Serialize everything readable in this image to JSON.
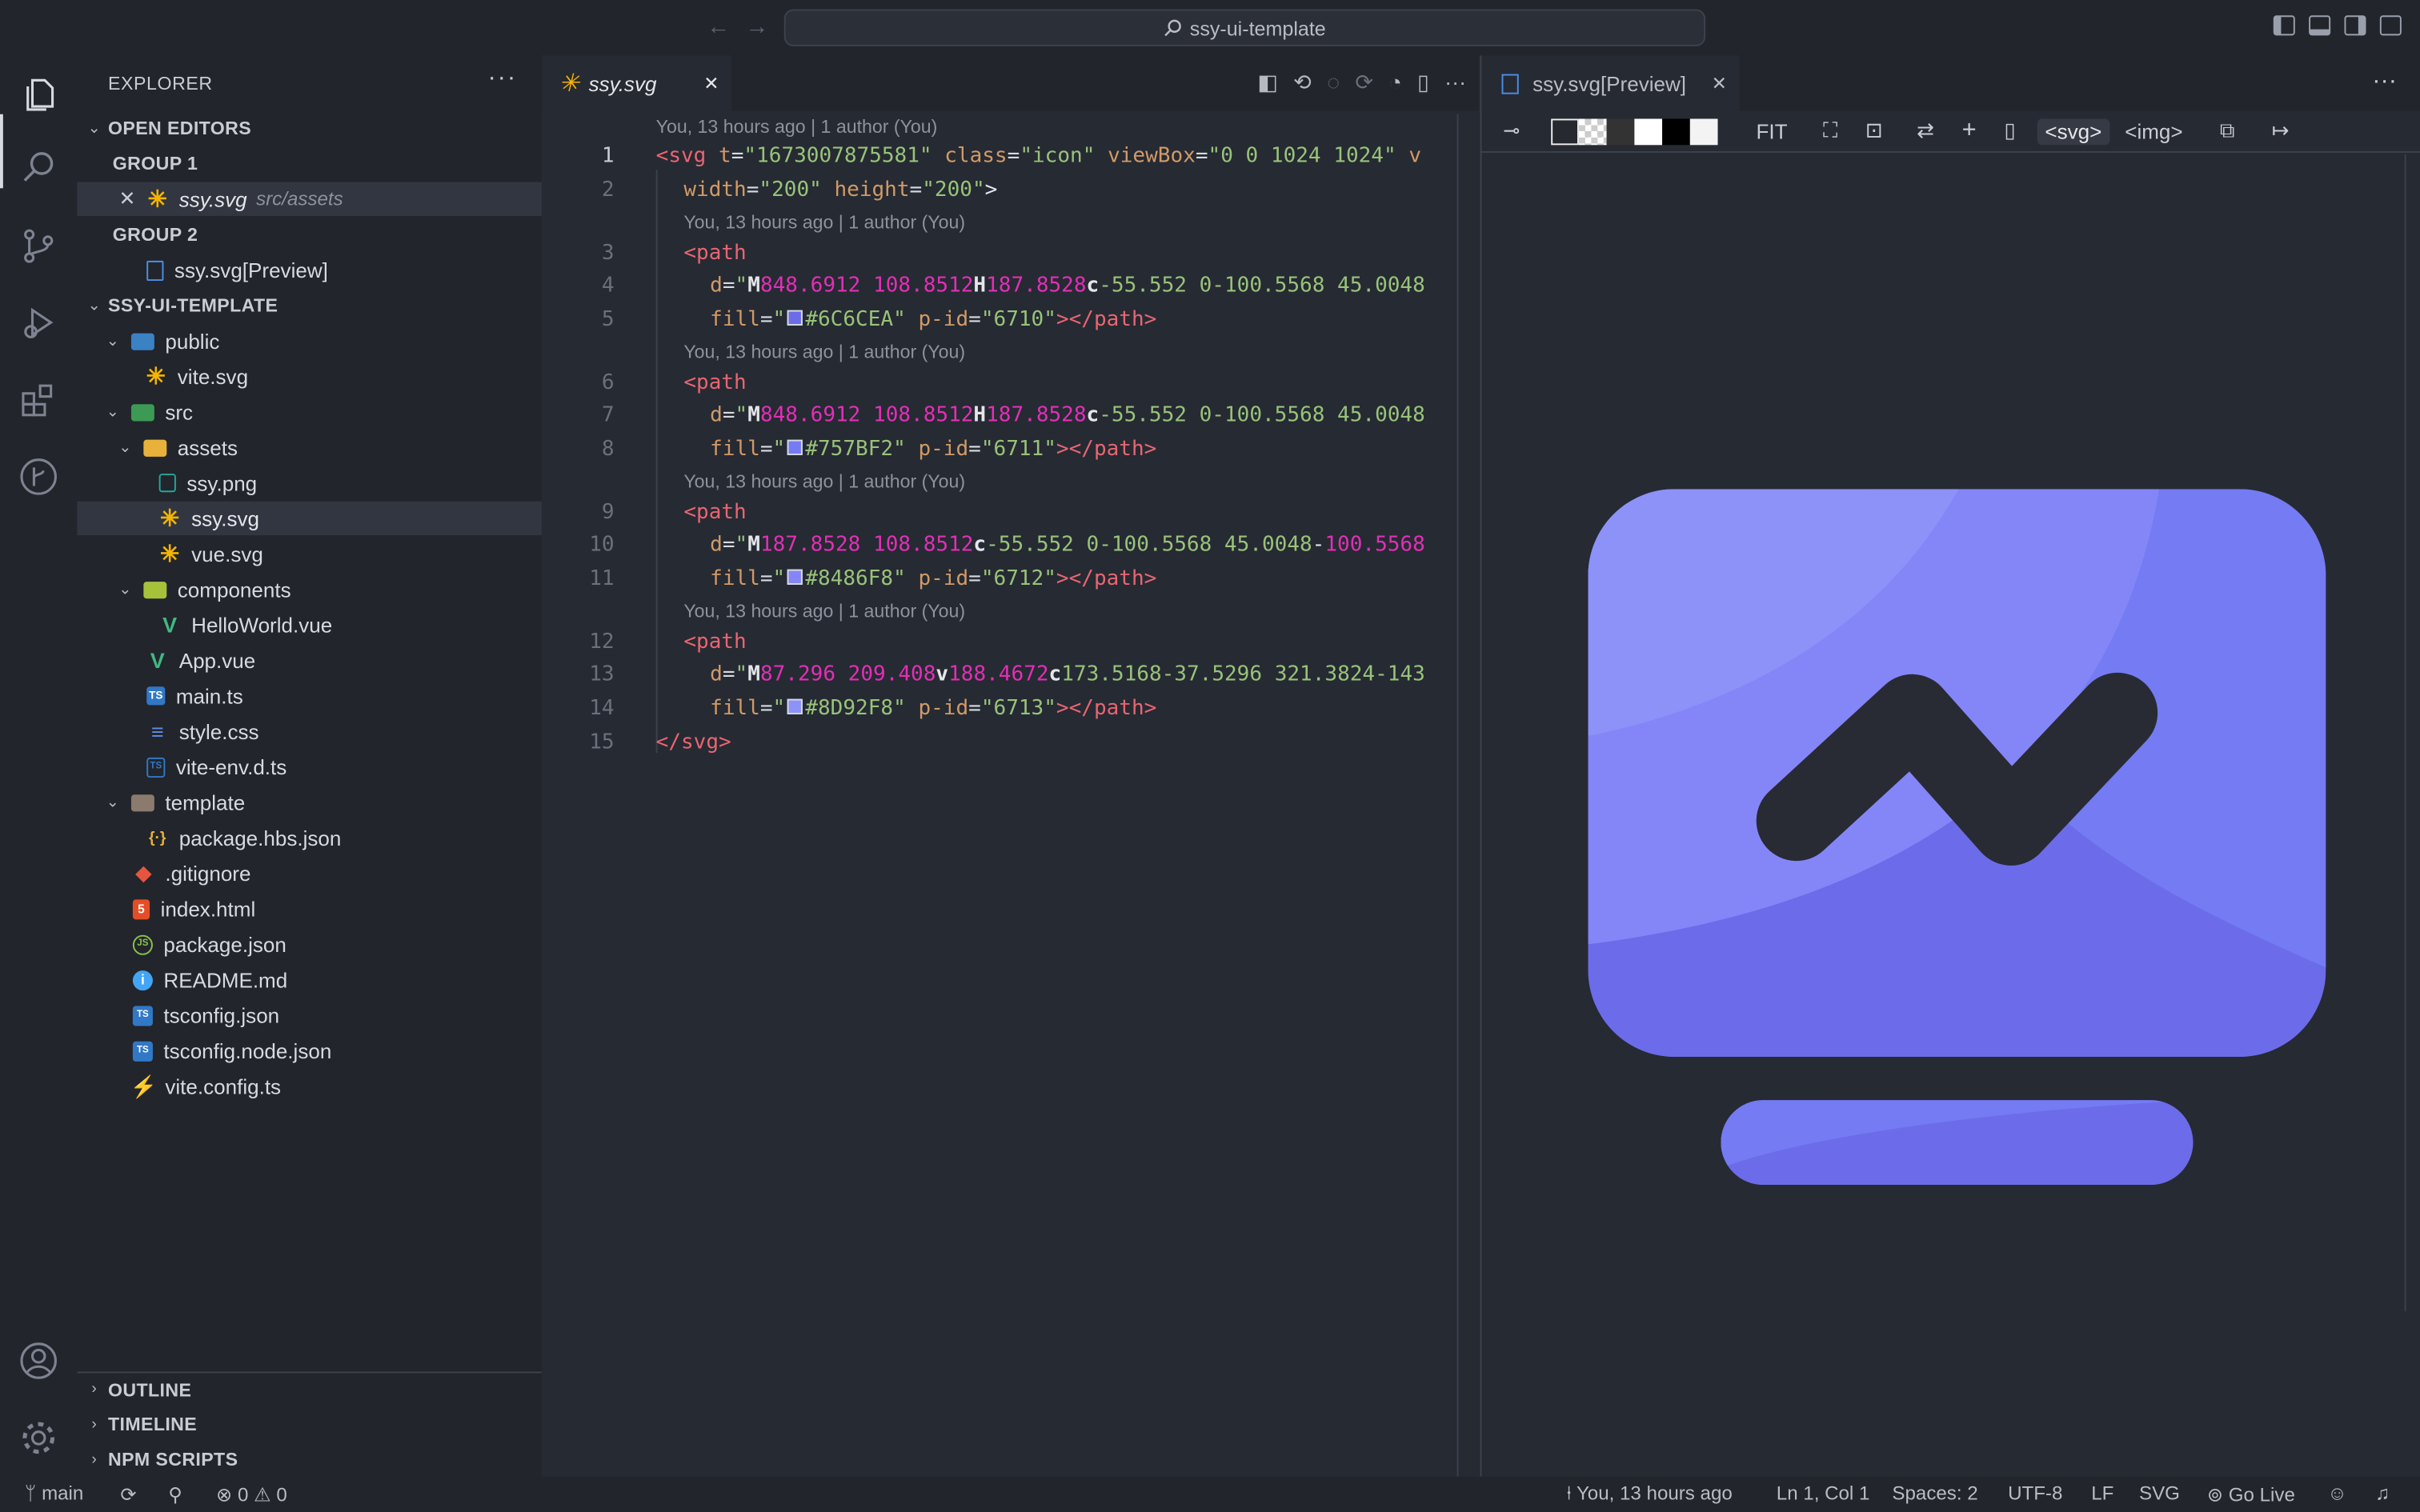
{
  "titlebar": {
    "search_text": "ssy-ui-template"
  },
  "sidebar": {
    "title": "EXPLORER",
    "open_editors": "OPEN EDITORS",
    "group1": "GROUP 1",
    "group1_file": "ssy.svg",
    "group1_path": "src/assets",
    "group2": "GROUP 2",
    "group2_file": "ssy.svg[Preview]",
    "project": "SSY-UI-TEMPLATE",
    "tree": [
      {
        "label": "public"
      },
      {
        "label": "vite.svg"
      },
      {
        "label": "src"
      },
      {
        "label": "assets"
      },
      {
        "label": "ssy.png"
      },
      {
        "label": "ssy.svg"
      },
      {
        "label": "vue.svg"
      },
      {
        "label": "components"
      },
      {
        "label": "HelloWorld.vue"
      },
      {
        "label": "App.vue"
      },
      {
        "label": "main.ts"
      },
      {
        "label": "style.css"
      },
      {
        "label": "vite-env.d.ts"
      },
      {
        "label": "template"
      },
      {
        "label": "package.hbs.json"
      },
      {
        "label": ".gitignore"
      },
      {
        "label": "index.html"
      },
      {
        "label": "package.json"
      },
      {
        "label": "README.md"
      },
      {
        "label": "tsconfig.json"
      },
      {
        "label": "tsconfig.node.json"
      },
      {
        "label": "vite.config.ts"
      }
    ],
    "outline": "OUTLINE",
    "timeline": "TIMELINE",
    "npm_scripts": "NPM SCRIPTS"
  },
  "editor": {
    "tab_label": "ssy.svg",
    "blame": "You, 13 hours ago | 1 author (You)",
    "line_numbers": [
      "1",
      "2",
      "3",
      "4",
      "5",
      "6",
      "7",
      "8",
      "9",
      "10",
      "11",
      "12",
      "13",
      "14",
      "15"
    ],
    "code": {
      "l1": {
        "tag": "<svg",
        "a1": " t",
        "v1": "\"1673007875581\"",
        "a2": " class",
        "v2": "\"icon\"",
        "a3": " viewBox",
        "v3": "\"0 0 1024 1024\"",
        "a4": " v"
      },
      "l2": {
        "a1": "width",
        "v1": "\"200\"",
        "a2": " height",
        "v2": "\"200\"",
        "close": ">"
      },
      "path_open": "<path",
      "l4": {
        "m1": "M",
        "p1": "848.6912 108.8512",
        "m2": "H",
        "p2": "187.8528",
        "m3": "c",
        "p3": "-55.552 0-100.5568 45.0048"
      },
      "l5_color": "#6C6CEA",
      "l5_pid": "\"6710\"",
      "l7": {
        "m1": "M",
        "p1": "848.6912 108.8512",
        "m2": "H",
        "p2": "187.8528",
        "m3": "c",
        "p3": "-55.552 0-100.5568 45.0048"
      },
      "l8_color": "#757BF2",
      "l8_pid": "\"6711\"",
      "l10": {
        "m1": "M",
        "p1": "187.8528 108.8512",
        "m2": "c",
        "p2": "-55.552 0-100.5568 45.0048",
        "m3": "-",
        "p3": "100.5568"
      },
      "l11_color": "#8486F8",
      "l11_pid": "\"6712\"",
      "l13": {
        "m1": "M",
        "p1": "87.296 209.408",
        "m2": "v",
        "p2": "188.4672",
        "m3": "c",
        "p3": "173.5168-37.5296 321.3824-143"
      },
      "l14_color": "#8D92F8",
      "l14_pid": "\"6713\"",
      "l15": "</svg>",
      "d_attr": "d",
      "fill_attr": "fill",
      "pid_attr": " p-id",
      "q": "\"",
      "eq": "=",
      "path_close": "></path>"
    }
  },
  "preview": {
    "tab_label": "ssy.svg[Preview]",
    "fit": "FIT",
    "svg_btn": "<svg>",
    "img_btn": "<img>",
    "colors": {
      "c1": "#6C6CEA",
      "c2": "#757BF2",
      "c3": "#8486F8",
      "c4": "#8D92F8",
      "stroke": "#282b33"
    }
  },
  "statusbar": {
    "branch": "main",
    "errors": "0",
    "warnings": "0",
    "blame": "You, 13 hours ago",
    "position": "Ln 1, Col 1",
    "spaces": "Spaces: 2",
    "encoding": "UTF-8",
    "eol": "LF",
    "language": "SVG",
    "golive": "Go Live"
  }
}
